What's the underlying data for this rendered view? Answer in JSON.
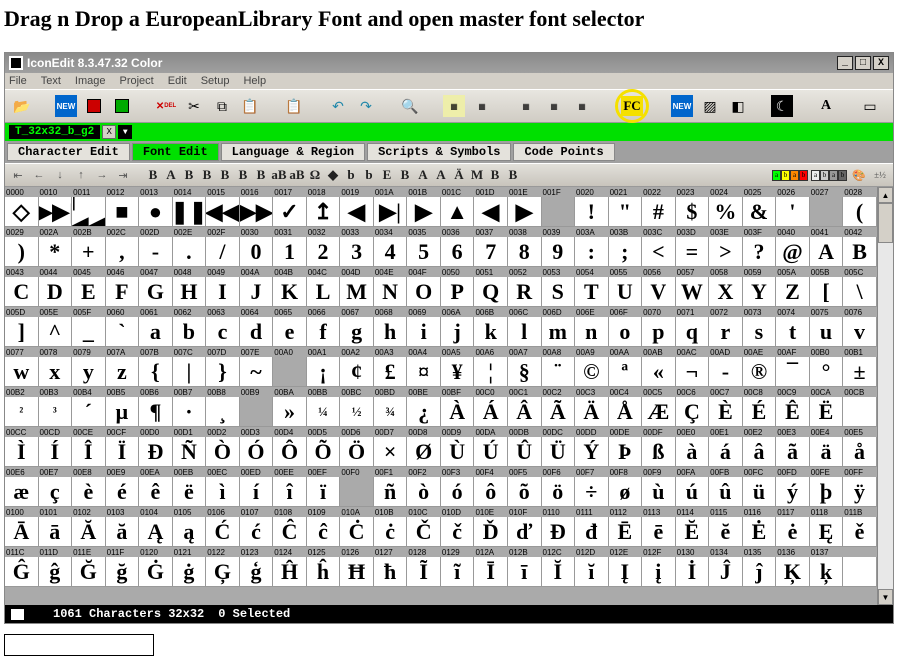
{
  "page_title": "Drag n Drop a EuropeanLibrary Font and open master font selector",
  "window": {
    "title": "IconEdit 8.3.47.32 Color",
    "sys": {
      "min": "_",
      "max": "□",
      "close": "X"
    }
  },
  "menu": [
    "File",
    "Text",
    "Image",
    "Project",
    "Edit",
    "Setup",
    "Help"
  ],
  "toolbar": {
    "highlight": "FC"
  },
  "tabstrip": {
    "tab": "T_32x32_b_g2",
    "close": "X",
    "drop": "▼"
  },
  "modes": [
    {
      "label": "Character Edit",
      "active": false
    },
    {
      "label": "Font Edit",
      "active": true
    },
    {
      "label": "Language & Region",
      "active": false
    },
    {
      "label": "Scripts & Symbols",
      "active": false
    },
    {
      "label": "Code Points",
      "active": false
    }
  ],
  "subtool_labels": [
    "B",
    "A",
    "B",
    "B",
    "B",
    "B",
    "B",
    "aB",
    "aB",
    "Ω",
    "◆",
    "b",
    "b",
    "E",
    "B",
    "A",
    "A",
    "Ä",
    "M",
    "B",
    "B"
  ],
  "status": {
    "count": "1061 Characters 32x32",
    "selected": "0 Selected"
  },
  "rows": [
    [
      {
        "c": "0000",
        "g": "◇"
      },
      {
        "c": "0010",
        "g": "▶▶|"
      },
      {
        "c": "0011",
        "g": "|◀◀"
      },
      {
        "c": "0012",
        "g": "■"
      },
      {
        "c": "0013",
        "g": "●"
      },
      {
        "c": "0014",
        "g": "❚❚"
      },
      {
        "c": "0015",
        "g": "◀◀"
      },
      {
        "c": "0016",
        "g": "▶▶"
      },
      {
        "c": "0017",
        "g": "✓"
      },
      {
        "c": "0018",
        "g": "↥"
      },
      {
        "c": "0019",
        "g": "◀"
      },
      {
        "c": "001A",
        "g": "▶|"
      },
      {
        "c": "001B",
        "g": "▶"
      },
      {
        "c": "001C",
        "g": "▲"
      },
      {
        "c": "001D",
        "g": "◀"
      },
      {
        "c": "001E",
        "g": "▶"
      },
      {
        "c": "001F",
        "g": "",
        "e": true
      },
      {
        "c": "0020",
        "g": "!"
      },
      {
        "c": "0021",
        "g": "\""
      },
      {
        "c": "0022",
        "g": "#"
      },
      {
        "c": "0023",
        "g": "$"
      },
      {
        "c": "0024",
        "g": "%"
      },
      {
        "c": "0025",
        "g": "&"
      },
      {
        "c": "0026",
        "g": "'"
      },
      {
        "c": "0027",
        "g": "",
        "e": true
      },
      {
        "c": "0028",
        "g": "("
      }
    ],
    [
      {
        "c": "0029",
        "g": ")"
      },
      {
        "c": "002A",
        "g": "*"
      },
      {
        "c": "002B",
        "g": "+"
      },
      {
        "c": "002C",
        "g": ","
      },
      {
        "c": "002D",
        "g": "-"
      },
      {
        "c": "002E",
        "g": "."
      },
      {
        "c": "002F",
        "g": "/"
      },
      {
        "c": "0030",
        "g": "0"
      },
      {
        "c": "0031",
        "g": "1"
      },
      {
        "c": "0032",
        "g": "2"
      },
      {
        "c": "0033",
        "g": "3"
      },
      {
        "c": "0034",
        "g": "4"
      },
      {
        "c": "0035",
        "g": "5"
      },
      {
        "c": "0036",
        "g": "6"
      },
      {
        "c": "0037",
        "g": "7"
      },
      {
        "c": "0038",
        "g": "8"
      },
      {
        "c": "0039",
        "g": "9"
      },
      {
        "c": "003A",
        "g": ":"
      },
      {
        "c": "003B",
        "g": ";"
      },
      {
        "c": "003C",
        "g": "<"
      },
      {
        "c": "003D",
        "g": "="
      },
      {
        "c": "003E",
        "g": ">"
      },
      {
        "c": "003F",
        "g": "?"
      },
      {
        "c": "0040",
        "g": "@"
      },
      {
        "c": "0041",
        "g": "A"
      },
      {
        "c": "0042",
        "g": "B"
      }
    ],
    [
      {
        "c": "0043",
        "g": "C"
      },
      {
        "c": "0044",
        "g": "D"
      },
      {
        "c": "0045",
        "g": "E"
      },
      {
        "c": "0046",
        "g": "F"
      },
      {
        "c": "0047",
        "g": "G"
      },
      {
        "c": "0048",
        "g": "H"
      },
      {
        "c": "0049",
        "g": "I"
      },
      {
        "c": "004A",
        "g": "J"
      },
      {
        "c": "004B",
        "g": "K"
      },
      {
        "c": "004C",
        "g": "L"
      },
      {
        "c": "004D",
        "g": "M"
      },
      {
        "c": "004E",
        "g": "N"
      },
      {
        "c": "004F",
        "g": "O"
      },
      {
        "c": "0050",
        "g": "P"
      },
      {
        "c": "0051",
        "g": "Q"
      },
      {
        "c": "0052",
        "g": "R"
      },
      {
        "c": "0053",
        "g": "S"
      },
      {
        "c": "0054",
        "g": "T"
      },
      {
        "c": "0055",
        "g": "U"
      },
      {
        "c": "0056",
        "g": "V"
      },
      {
        "c": "0057",
        "g": "W"
      },
      {
        "c": "0058",
        "g": "X"
      },
      {
        "c": "0059",
        "g": "Y"
      },
      {
        "c": "005A",
        "g": "Z"
      },
      {
        "c": "005B",
        "g": "["
      },
      {
        "c": "005C",
        "g": "\\"
      }
    ],
    [
      {
        "c": "005D",
        "g": "]"
      },
      {
        "c": "005E",
        "g": "^"
      },
      {
        "c": "005F",
        "g": "_"
      },
      {
        "c": "0060",
        "g": "`"
      },
      {
        "c": "0061",
        "g": "a"
      },
      {
        "c": "0062",
        "g": "b"
      },
      {
        "c": "0063",
        "g": "c"
      },
      {
        "c": "0064",
        "g": "d"
      },
      {
        "c": "0065",
        "g": "e"
      },
      {
        "c": "0066",
        "g": "f"
      },
      {
        "c": "0067",
        "g": "g"
      },
      {
        "c": "0068",
        "g": "h"
      },
      {
        "c": "0069",
        "g": "i"
      },
      {
        "c": "006A",
        "g": "j"
      },
      {
        "c": "006B",
        "g": "k"
      },
      {
        "c": "006C",
        "g": "l"
      },
      {
        "c": "006D",
        "g": "m"
      },
      {
        "c": "006E",
        "g": "n"
      },
      {
        "c": "006F",
        "g": "o"
      },
      {
        "c": "0070",
        "g": "p"
      },
      {
        "c": "0071",
        "g": "q"
      },
      {
        "c": "0072",
        "g": "r"
      },
      {
        "c": "0073",
        "g": "s"
      },
      {
        "c": "0074",
        "g": "t"
      },
      {
        "c": "0075",
        "g": "u"
      },
      {
        "c": "0076",
        "g": "v"
      }
    ],
    [
      {
        "c": "0077",
        "g": "w"
      },
      {
        "c": "0078",
        "g": "x"
      },
      {
        "c": "0079",
        "g": "y"
      },
      {
        "c": "007A",
        "g": "z"
      },
      {
        "c": "007B",
        "g": "{"
      },
      {
        "c": "007C",
        "g": "|"
      },
      {
        "c": "007D",
        "g": "}"
      },
      {
        "c": "007E",
        "g": "~"
      },
      {
        "c": "00A0",
        "g": "",
        "e": true
      },
      {
        "c": "00A1",
        "g": "¡"
      },
      {
        "c": "00A2",
        "g": "¢"
      },
      {
        "c": "00A3",
        "g": "£"
      },
      {
        "c": "00A4",
        "g": "¤"
      },
      {
        "c": "00A5",
        "g": "¥"
      },
      {
        "c": "00A6",
        "g": "¦"
      },
      {
        "c": "00A7",
        "g": "§"
      },
      {
        "c": "00A8",
        "g": "¨"
      },
      {
        "c": "00A9",
        "g": "©"
      },
      {
        "c": "00AA",
        "g": "ª"
      },
      {
        "c": "00AB",
        "g": "«"
      },
      {
        "c": "00AC",
        "g": "¬"
      },
      {
        "c": "00AD",
        "g": "-"
      },
      {
        "c": "00AE",
        "g": "®"
      },
      {
        "c": "00AF",
        "g": "¯"
      },
      {
        "c": "00B0",
        "g": "°"
      },
      {
        "c": "00B1",
        "g": "±"
      }
    ],
    [
      {
        "c": "00B2",
        "g": "²",
        "s": true
      },
      {
        "c": "00B3",
        "g": "³",
        "s": true
      },
      {
        "c": "00B4",
        "g": "´"
      },
      {
        "c": "00B5",
        "g": "µ"
      },
      {
        "c": "00B6",
        "g": "¶"
      },
      {
        "c": "00B7",
        "g": "·"
      },
      {
        "c": "00B8",
        "g": "¸"
      },
      {
        "c": "00B9",
        "g": "",
        "e": true
      },
      {
        "c": "00BA",
        "g": "»"
      },
      {
        "c": "00BB",
        "g": "¼",
        "s": true
      },
      {
        "c": "00BC",
        "g": "½",
        "s": true
      },
      {
        "c": "00BD",
        "g": "¾",
        "s": true
      },
      {
        "c": "00BE",
        "g": "¿"
      },
      {
        "c": "00BF",
        "g": "À"
      },
      {
        "c": "00C0",
        "g": "Á"
      },
      {
        "c": "00C1",
        "g": "Â"
      },
      {
        "c": "00C2",
        "g": "Ã"
      },
      {
        "c": "00C3",
        "g": "Ä"
      },
      {
        "c": "00C4",
        "g": "Å"
      },
      {
        "c": "00C5",
        "g": "Æ"
      },
      {
        "c": "00C6",
        "g": "Ç"
      },
      {
        "c": "00C7",
        "g": "È"
      },
      {
        "c": "00C8",
        "g": "É"
      },
      {
        "c": "00C9",
        "g": "Ê"
      },
      {
        "c": "00CA",
        "g": "Ë"
      },
      {
        "c": "00CB",
        "g": ""
      }
    ],
    [
      {
        "c": "00CC",
        "g": "Ì"
      },
      {
        "c": "00CD",
        "g": "Í"
      },
      {
        "c": "00CE",
        "g": "Î"
      },
      {
        "c": "00CF",
        "g": "Ï"
      },
      {
        "c": "00D0",
        "g": "Đ"
      },
      {
        "c": "00D1",
        "g": "Ñ"
      },
      {
        "c": "00D2",
        "g": "Ò"
      },
      {
        "c": "00D3",
        "g": "Ó"
      },
      {
        "c": "00D4",
        "g": "Ô"
      },
      {
        "c": "00D5",
        "g": "Õ"
      },
      {
        "c": "00D6",
        "g": "Ö"
      },
      {
        "c": "00D7",
        "g": "×"
      },
      {
        "c": "00D8",
        "g": "Ø"
      },
      {
        "c": "00D9",
        "g": "Ù"
      },
      {
        "c": "00DA",
        "g": "Ú"
      },
      {
        "c": "00DB",
        "g": "Û"
      },
      {
        "c": "00DC",
        "g": "Ü"
      },
      {
        "c": "00DD",
        "g": "Ý"
      },
      {
        "c": "00DE",
        "g": "Þ"
      },
      {
        "c": "00DF",
        "g": "ß"
      },
      {
        "c": "00E0",
        "g": "à"
      },
      {
        "c": "00E1",
        "g": "á"
      },
      {
        "c": "00E2",
        "g": "â"
      },
      {
        "c": "00E3",
        "g": "ã"
      },
      {
        "c": "00E4",
        "g": "ä"
      },
      {
        "c": "00E5",
        "g": "å"
      }
    ],
    [
      {
        "c": "00E6",
        "g": "æ"
      },
      {
        "c": "00E7",
        "g": "ç"
      },
      {
        "c": "00E8",
        "g": "è"
      },
      {
        "c": "00E9",
        "g": "é"
      },
      {
        "c": "00EA",
        "g": "ê"
      },
      {
        "c": "00EB",
        "g": "ë"
      },
      {
        "c": "00EC",
        "g": "ì"
      },
      {
        "c": "00ED",
        "g": "í"
      },
      {
        "c": "00EE",
        "g": "î"
      },
      {
        "c": "00EF",
        "g": "ï"
      },
      {
        "c": "00F0",
        "g": "",
        "e": true
      },
      {
        "c": "00F1",
        "g": "ñ"
      },
      {
        "c": "00F2",
        "g": "ò"
      },
      {
        "c": "00F3",
        "g": "ó"
      },
      {
        "c": "00F4",
        "g": "ô"
      },
      {
        "c": "00F5",
        "g": "õ"
      },
      {
        "c": "00F6",
        "g": "ö"
      },
      {
        "c": "00F7",
        "g": "÷"
      },
      {
        "c": "00F8",
        "g": "ø"
      },
      {
        "c": "00F9",
        "g": "ù"
      },
      {
        "c": "00FA",
        "g": "ú"
      },
      {
        "c": "00FB",
        "g": "û"
      },
      {
        "c": "00FC",
        "g": "ü"
      },
      {
        "c": "00FD",
        "g": "ý"
      },
      {
        "c": "00FE",
        "g": "þ"
      },
      {
        "c": "00FF",
        "g": "ÿ"
      }
    ],
    [
      {
        "c": "0100",
        "g": "Ā"
      },
      {
        "c": "0101",
        "g": "ā"
      },
      {
        "c": "0102",
        "g": "Ă"
      },
      {
        "c": "0103",
        "g": "ă"
      },
      {
        "c": "0104",
        "g": "Ą"
      },
      {
        "c": "0105",
        "g": "ą"
      },
      {
        "c": "0106",
        "g": "Ć"
      },
      {
        "c": "0107",
        "g": "ć"
      },
      {
        "c": "0108",
        "g": "Ĉ"
      },
      {
        "c": "0109",
        "g": "ĉ"
      },
      {
        "c": "010A",
        "g": "Ċ"
      },
      {
        "c": "010B",
        "g": "ċ"
      },
      {
        "c": "010C",
        "g": "Č"
      },
      {
        "c": "010D",
        "g": "č"
      },
      {
        "c": "010E",
        "g": "Ď"
      },
      {
        "c": "010F",
        "g": "ď"
      },
      {
        "c": "0110",
        "g": "Đ"
      },
      {
        "c": "0111",
        "g": "đ"
      },
      {
        "c": "0112",
        "g": "Ē"
      },
      {
        "c": "0113",
        "g": "ē"
      },
      {
        "c": "0114",
        "g": "Ĕ"
      },
      {
        "c": "0115",
        "g": "ĕ"
      },
      {
        "c": "0116",
        "g": "Ė"
      },
      {
        "c": "0117",
        "g": "ė"
      },
      {
        "c": "0118",
        "g": "Ę"
      },
      {
        "c": "011B",
        "g": "ě"
      }
    ],
    [
      {
        "c": "011C",
        "g": "Ĝ"
      },
      {
        "c": "011D",
        "g": "ĝ"
      },
      {
        "c": "011E",
        "g": "Ğ"
      },
      {
        "c": "011F",
        "g": "ğ"
      },
      {
        "c": "0120",
        "g": "Ġ"
      },
      {
        "c": "0121",
        "g": "ġ"
      },
      {
        "c": "0122",
        "g": "Ģ"
      },
      {
        "c": "0123",
        "g": "ģ"
      },
      {
        "c": "0124",
        "g": "Ĥ"
      },
      {
        "c": "0125",
        "g": "ĥ"
      },
      {
        "c": "0126",
        "g": "Ħ"
      },
      {
        "c": "0127",
        "g": "ħ"
      },
      {
        "c": "0128",
        "g": "Ĩ"
      },
      {
        "c": "0129",
        "g": "ĩ"
      },
      {
        "c": "012A",
        "g": "Ī"
      },
      {
        "c": "012B",
        "g": "ī"
      },
      {
        "c": "012C",
        "g": "Ĭ"
      },
      {
        "c": "012D",
        "g": "ĭ"
      },
      {
        "c": "012E",
        "g": "Į"
      },
      {
        "c": "012F",
        "g": "į"
      },
      {
        "c": "0130",
        "g": "İ"
      },
      {
        "c": "0134",
        "g": "Ĵ"
      },
      {
        "c": "0135",
        "g": "ĵ"
      },
      {
        "c": "0136",
        "g": "Ķ"
      },
      {
        "c": "0137",
        "g": "ķ"
      },
      {
        "c": "",
        "g": ""
      }
    ]
  ]
}
